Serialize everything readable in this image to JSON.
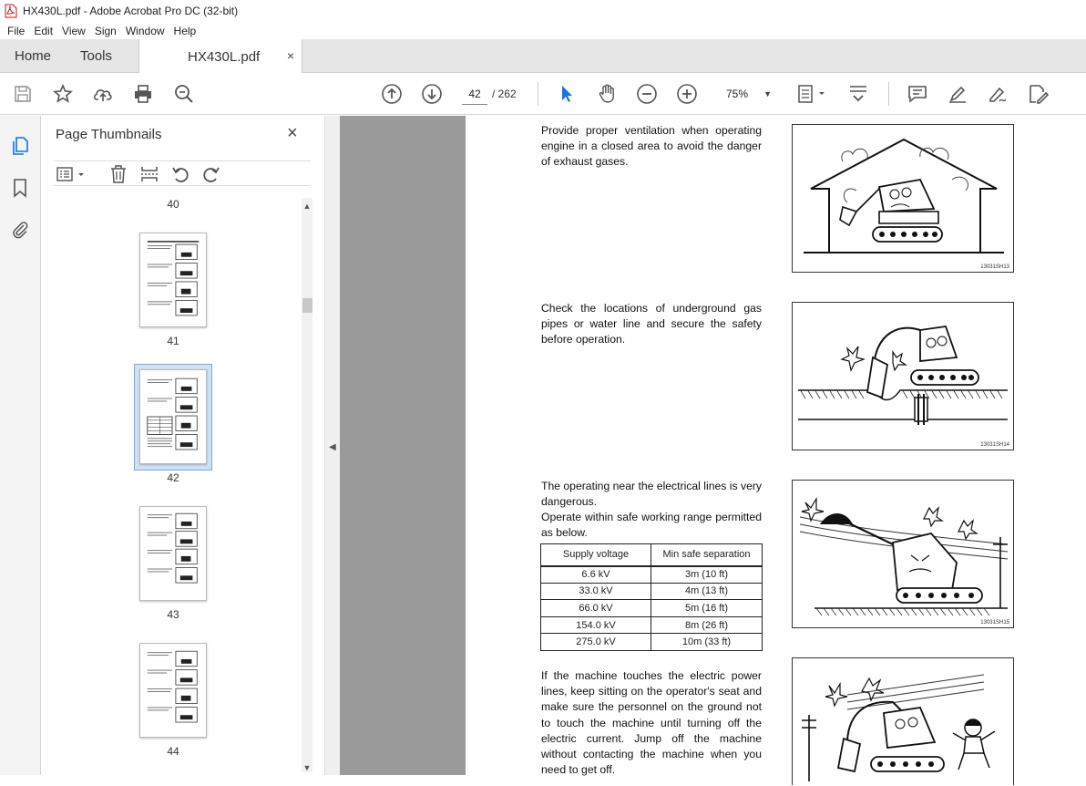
{
  "window": {
    "title": "HX430L.pdf - Adobe Acrobat Pro DC (32-bit)"
  },
  "menu": [
    "File",
    "Edit",
    "View",
    "Sign",
    "Window",
    "Help"
  ],
  "tabs": {
    "home": "Home",
    "tools": "Tools",
    "doc": "HX430L.pdf",
    "close": "×"
  },
  "toolbar": {
    "page_current": "42",
    "page_total": "/ 262",
    "zoom": "75%"
  },
  "thumbnails": {
    "title": "Page Thumbnails",
    "close": "×",
    "pages": [
      {
        "label": "40"
      },
      {
        "label": "41"
      },
      {
        "label": "42",
        "selected": true
      },
      {
        "label": "43"
      },
      {
        "label": "44"
      }
    ]
  },
  "document": {
    "para1": "Provide proper ventilation when operating engine in a closed area to avoid the danger of exhaust gases.",
    "para2": "Check the locations of underground gas pipes or water line and secure the safety before operation.",
    "para3a": "The operating near the electrical lines is very dangerous.",
    "para3b": "Operate within safe working range permitted as below.",
    "para4": "If the machine touches the electric power lines, keep sitting on the operator's seat and make sure the personnel on the ground not to touch the machine until turning off the electric current. Jump off the machine without contacting the machine when you need to get off.",
    "fig_codes": [
      "13031SH13",
      "13031SH14",
      "13031SH15"
    ],
    "table": {
      "headers": [
        "Supply voltage",
        "Min safe separation"
      ],
      "rows": [
        [
          "6.6 kV",
          "3m (10 ft)"
        ],
        [
          "33.0 kV",
          "4m (13 ft)"
        ],
        [
          "66.0 kV",
          "5m (16 ft)"
        ],
        [
          "154.0 kV",
          "8m (26 ft)"
        ],
        [
          "275.0 kV",
          "10m (33 ft)"
        ]
      ]
    }
  }
}
